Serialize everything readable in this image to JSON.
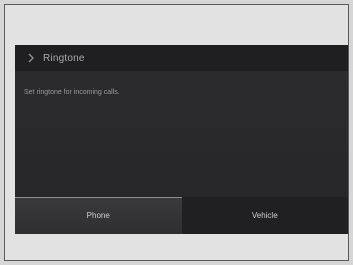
{
  "header": {
    "back_icon": "chevron-right-icon",
    "title": "Ringtone"
  },
  "description": "Set ringtone for incoming calls.",
  "tabs": [
    {
      "label": "Phone",
      "active": true
    },
    {
      "label": "Vehicle",
      "active": false
    }
  ],
  "colors": {
    "screen_bg": "#2a2a2c",
    "header_bg": "#1f1f21",
    "text": "#a9a9a9"
  }
}
